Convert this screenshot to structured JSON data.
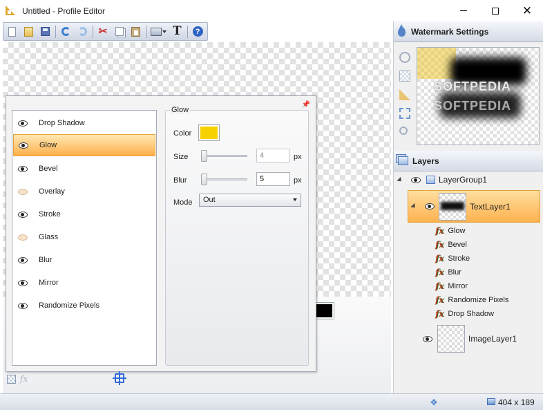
{
  "window": {
    "title": "Untitled - Profile Editor",
    "minimize_glyph": "",
    "close_glyph": "✕"
  },
  "toolbar": {
    "buttons": [
      {
        "icon": "new-document-icon"
      },
      {
        "icon": "open-folder-icon"
      },
      {
        "icon": "save-icon"
      },
      {
        "icon": "undo-icon"
      },
      {
        "icon": "redo-icon"
      },
      {
        "icon": "cut-icon"
      },
      {
        "icon": "copy-icon"
      },
      {
        "icon": "paste-icon"
      },
      {
        "icon": "image-dropdown-icon"
      },
      {
        "icon": "text-icon"
      },
      {
        "icon": "help-icon"
      }
    ],
    "cut_glyph": "✂",
    "text_glyph": "T",
    "help_glyph": "?"
  },
  "effects": {
    "pin_glyph": "📌",
    "items": [
      {
        "label": "Drop Shadow",
        "enabled": true,
        "selected": false
      },
      {
        "label": "Glow",
        "enabled": true,
        "selected": true
      },
      {
        "label": "Bevel",
        "enabled": true,
        "selected": false
      },
      {
        "label": "Overlay",
        "enabled": false,
        "selected": false
      },
      {
        "label": "Stroke",
        "enabled": true,
        "selected": false
      },
      {
        "label": "Glass",
        "enabled": false,
        "selected": false
      },
      {
        "label": "Blur",
        "enabled": true,
        "selected": false
      },
      {
        "label": "Mirror",
        "enabled": true,
        "selected": false
      },
      {
        "label": "Randomize Pixels",
        "enabled": true,
        "selected": false
      }
    ],
    "glow": {
      "group_title": "Glow",
      "color_label": "Color",
      "color_value": "#f7d100",
      "size_label": "Size",
      "size_value": "4",
      "size_unit": "px",
      "blur_label": "Blur",
      "blur_value": "5",
      "blur_unit": "px",
      "mode_label": "Mode",
      "mode_value": "Out"
    },
    "fx_glyph": "fx"
  },
  "watermark_panel": {
    "title": "Watermark Settings",
    "preview_text": "SOFTPEDIA"
  },
  "layers_panel": {
    "title": "Layers",
    "group": {
      "name": "LayerGroup1"
    },
    "text_layer": {
      "name": "TextLayer1",
      "selected": true
    },
    "effects": [
      "Glow",
      "Bevel",
      "Stroke",
      "Blur",
      "Mirror",
      "Randomize Pixels",
      "Drop Shadow"
    ],
    "fx_glyph": "fx",
    "image_layer": {
      "name": "ImageLayer1"
    }
  },
  "status": {
    "move_glyph": "✥",
    "dimensions": "404 x 189"
  }
}
